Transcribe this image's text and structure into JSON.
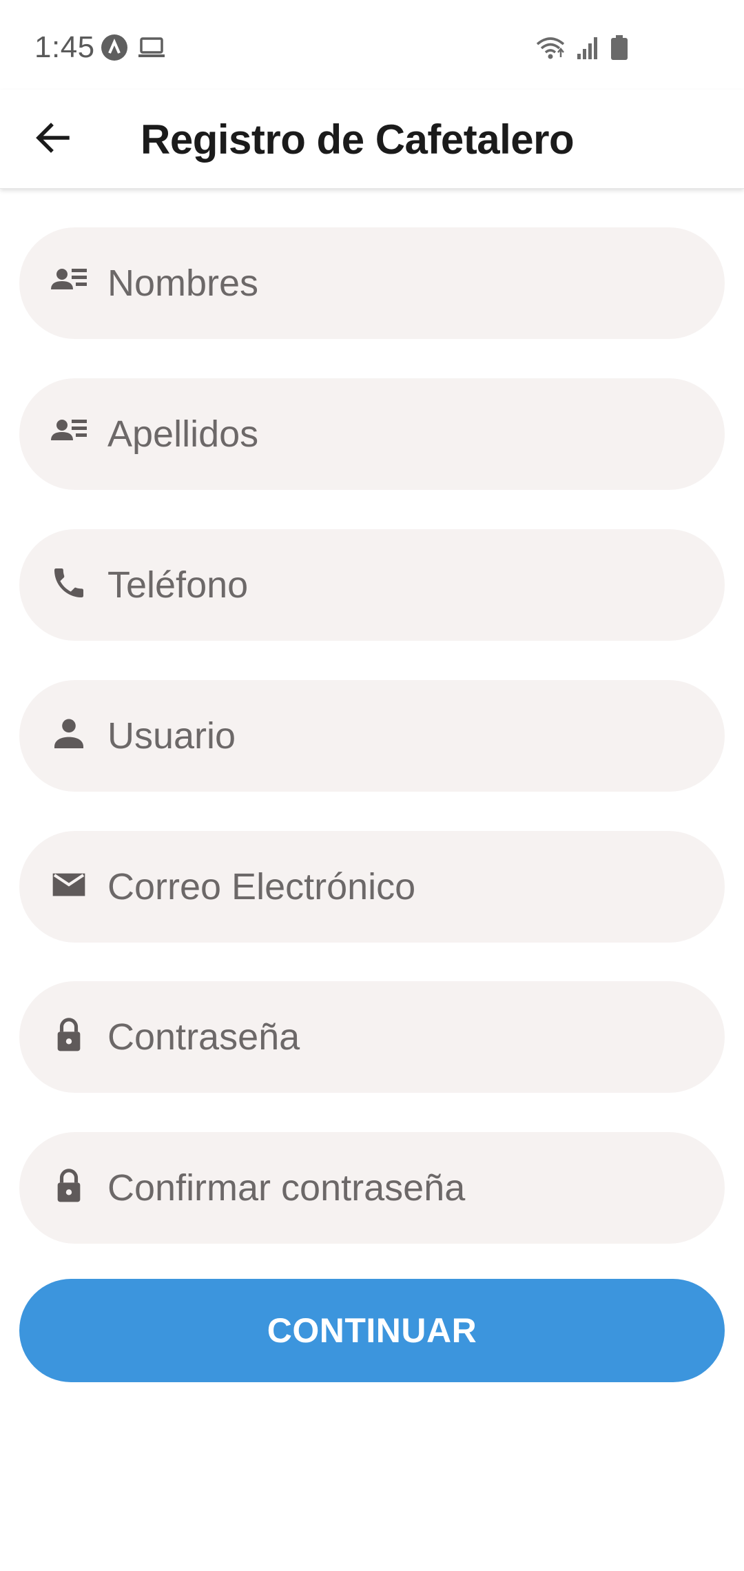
{
  "status_bar": {
    "time": "1:45",
    "left_icons": [
      "app-notification-icon",
      "laptop-icon"
    ],
    "right_icons": [
      "wifi-icon",
      "signal-icon",
      "battery-icon"
    ]
  },
  "app_bar": {
    "back_icon": "arrow-left-icon",
    "title": "Registro de Cafetalero"
  },
  "form": {
    "fields": [
      {
        "icon": "contact-card-icon",
        "placeholder": "Nombres",
        "value": ""
      },
      {
        "icon": "contact-card-icon",
        "placeholder": "Apellidos",
        "value": ""
      },
      {
        "icon": "phone-icon",
        "placeholder": "Teléfono",
        "value": ""
      },
      {
        "icon": "person-icon",
        "placeholder": "Usuario",
        "value": ""
      },
      {
        "icon": "mail-icon",
        "placeholder": "Correo Electrónico",
        "value": ""
      },
      {
        "icon": "lock-icon",
        "placeholder": "Contraseña",
        "value": ""
      },
      {
        "icon": "lock-icon",
        "placeholder": "Confirmar contraseña",
        "value": ""
      }
    ],
    "submit_label": "CONTINUAR"
  },
  "colors": {
    "primary_button": "#3c95dd",
    "field_background": "#f6f2f1",
    "field_text": "#6c6868",
    "icon": "#5f5a5a"
  }
}
